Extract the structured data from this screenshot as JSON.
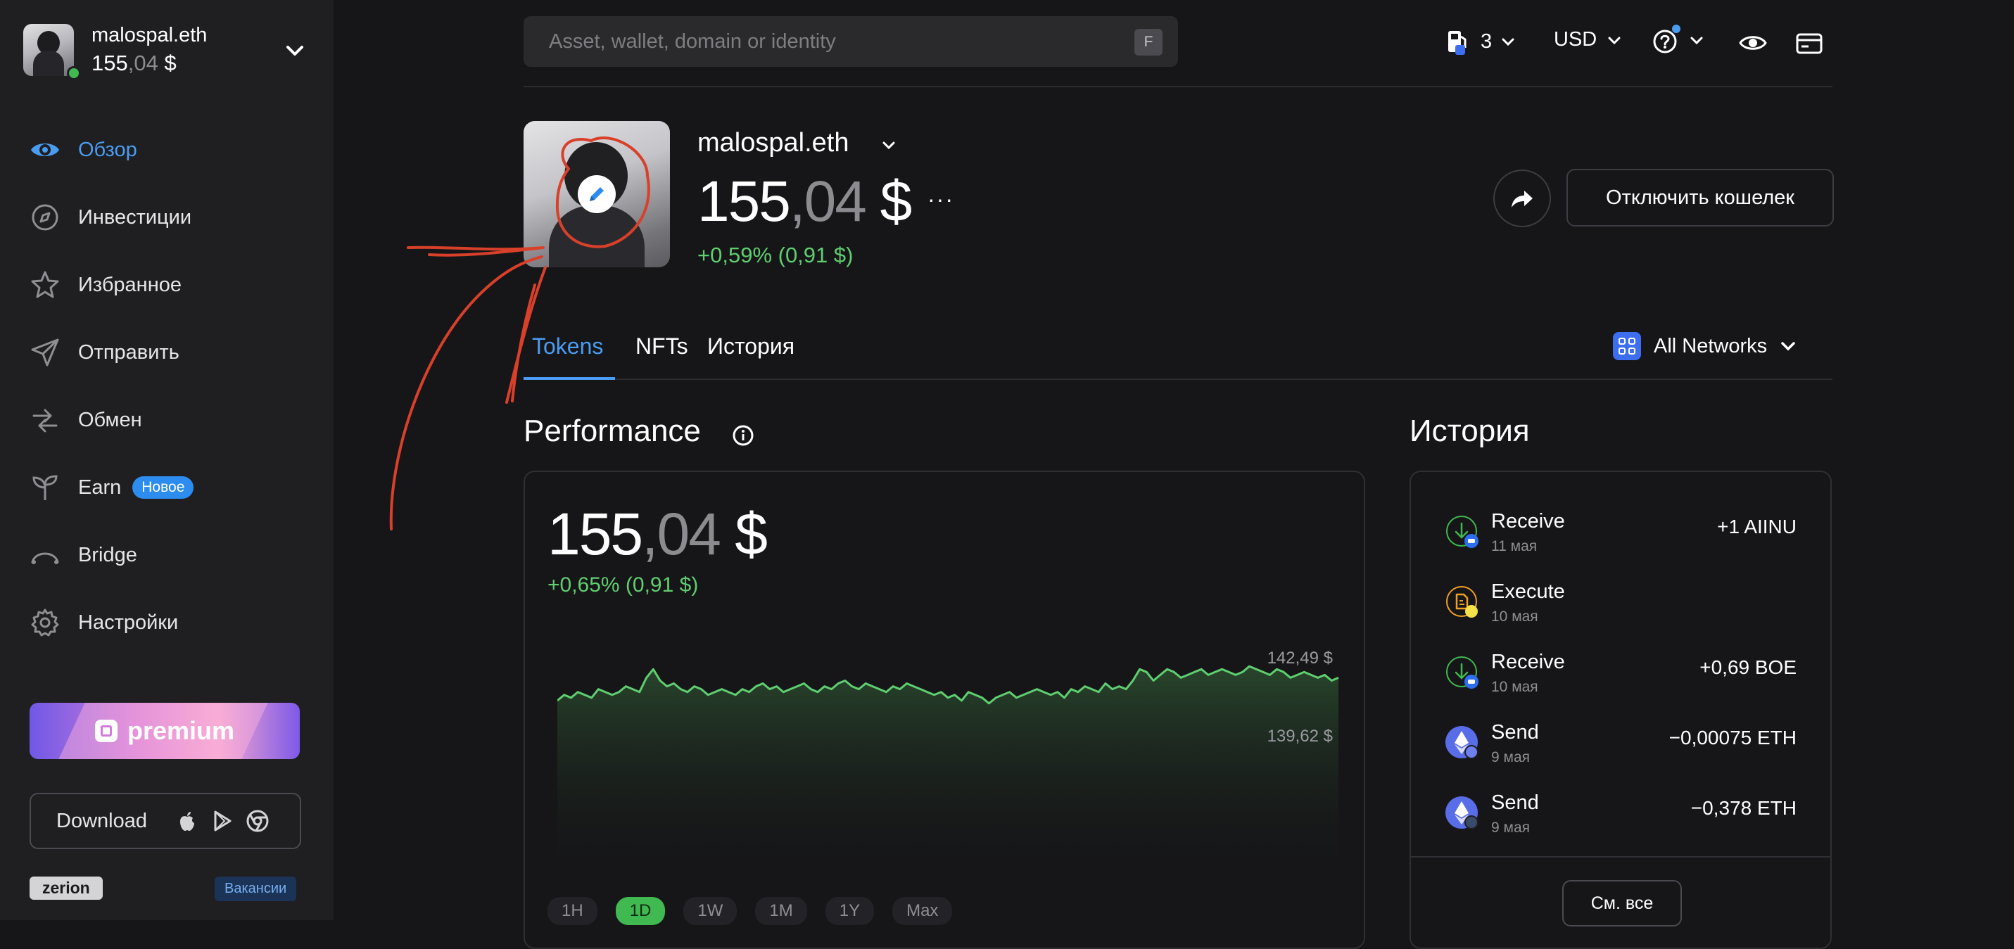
{
  "account": {
    "name": "malospal.eth",
    "balance_int": "155",
    "balance_dec": ",04",
    "balance_cur": " $"
  },
  "nav": [
    {
      "label": "Обзор",
      "icon": "eye-icon",
      "active": true
    },
    {
      "label": "Инвестиции",
      "icon": "compass-icon"
    },
    {
      "label": "Избранное",
      "icon": "star-icon"
    },
    {
      "label": "Отправить",
      "icon": "send-icon"
    },
    {
      "label": "Обмен",
      "icon": "swap-icon"
    },
    {
      "label": "Earn",
      "icon": "sprout-icon",
      "badge": "Новое"
    },
    {
      "label": "Bridge",
      "icon": "bridge-icon"
    },
    {
      "label": "Настройки",
      "icon": "gear-icon"
    }
  ],
  "premium": {
    "label": "premium"
  },
  "download": {
    "label": "Download"
  },
  "footer": {
    "brand": "zerion",
    "jobs": "Вакансии"
  },
  "search": {
    "placeholder": "Asset, wallet, domain or identity",
    "shortcut": "F"
  },
  "topbar": {
    "gas": "3",
    "currency": "USD"
  },
  "profile": {
    "name": "malospal.eth",
    "balance_int": "155",
    "balance_dec": ",04",
    "balance_cur": " $",
    "more": "···",
    "change": "+0,59% (0,91 $)",
    "disconnect": "Отключить кошелек"
  },
  "tabs": [
    "Tokens",
    "NFTs",
    "История"
  ],
  "networks": {
    "label": "All Networks"
  },
  "performance": {
    "title": "Performance",
    "value_int": "155",
    "value_dec": ",04",
    "value_cur": " $",
    "change": "+0,65% (0,91 $)",
    "ranges": [
      "1H",
      "1D",
      "1W",
      "1M",
      "1Y",
      "Max"
    ],
    "active_range": "1D"
  },
  "chart_data": {
    "type": "area",
    "title": "",
    "xlabel": "",
    "ylabel": "",
    "annotations": [
      "142,49 $",
      "139,62 $"
    ],
    "color": "#5fce70",
    "ylim": [
      139.2,
      142.9
    ],
    "values": [
      141.3,
      141.5,
      141.4,
      141.6,
      141.5,
      141.4,
      141.7,
      141.6,
      141.5,
      141.6,
      141.8,
      141.7,
      141.6,
      142.1,
      142.4,
      142.0,
      141.8,
      141.9,
      141.7,
      141.6,
      141.8,
      141.7,
      141.5,
      141.6,
      141.7,
      141.6,
      141.5,
      141.7,
      141.6,
      141.8,
      141.9,
      141.7,
      141.8,
      141.6,
      141.7,
      141.8,
      141.9,
      141.7,
      141.6,
      141.8,
      141.7,
      141.9,
      142.0,
      141.8,
      141.7,
      141.9,
      141.8,
      141.7,
      141.6,
      141.8,
      141.7,
      141.9,
      141.8,
      141.7,
      141.6,
      141.5,
      141.6,
      141.4,
      141.5,
      141.3,
      141.6,
      141.5,
      141.4,
      141.2,
      141.4,
      141.5,
      141.6,
      141.4,
      141.5,
      141.6,
      141.7,
      141.6,
      141.5,
      141.6,
      141.4,
      141.7,
      141.6,
      141.8,
      141.7,
      141.6,
      141.9,
      141.7,
      141.8,
      141.7,
      142.0,
      142.4,
      142.3,
      142.0,
      142.2,
      142.4,
      142.3,
      142.1,
      142.2,
      142.3,
      142.4,
      142.2,
      142.3,
      142.4,
      142.3,
      142.2,
      142.3,
      142.5,
      142.4,
      142.3,
      142.2,
      142.4,
      142.3,
      142.1,
      142.2,
      142.3,
      142.2,
      142.1,
      142.2,
      142.0,
      142.1
    ]
  },
  "history": {
    "title": "История",
    "items": [
      {
        "type": "Receive",
        "date": "11 мая",
        "amount": "+1 AIINU",
        "icon": "receive-icon"
      },
      {
        "type": "Execute",
        "date": "10 мая",
        "amount": "",
        "icon": "execute-icon"
      },
      {
        "type": "Receive",
        "date": "10 мая",
        "amount": "+0,69 BOE",
        "icon": "receive-icon"
      },
      {
        "type": "Send",
        "date": "9 мая",
        "amount": "−0,00075 ETH",
        "icon": "eth-send-icon"
      },
      {
        "type": "Send",
        "date": "9 мая",
        "amount": "−0,378 ETH",
        "icon": "eth-send-icon"
      }
    ],
    "see_all": "См. все"
  }
}
